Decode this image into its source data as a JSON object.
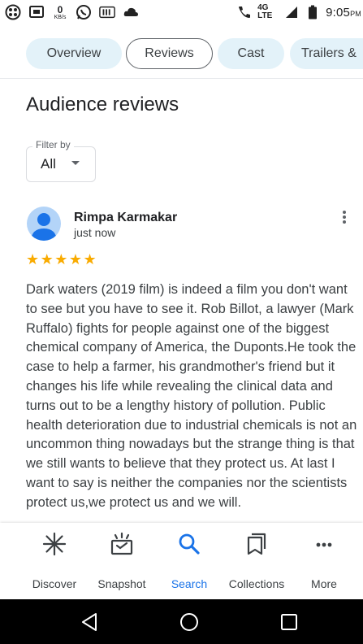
{
  "status_bar": {
    "left_icons": [
      "app-icon",
      "screen-icon",
      "data-speed-icon",
      "whatsapp-icon",
      "app-box-icon",
      "cloud-icon"
    ],
    "data_speed_value": "0",
    "data_speed_unit": "KB/s",
    "network_label": "4G LTE",
    "time": "9:05",
    "time_suffix": "PM"
  },
  "tabs": [
    {
      "label": "Overview",
      "active": false
    },
    {
      "label": "Reviews",
      "active": true
    },
    {
      "label": "Cast",
      "active": false
    },
    {
      "label": "Trailers &",
      "active": false
    }
  ],
  "section": {
    "title": "Audience reviews"
  },
  "filter": {
    "label": "Filter by",
    "value": "All"
  },
  "review": {
    "author": "Rimpa Karmakar",
    "time": "just now",
    "stars": "★★★★★",
    "rating": 5,
    "text": "Dark waters (2019 film) is indeed a film you don't want to see but you have to see it. Rob Billot, a lawyer (Mark Ruffalo) fights for people against one of the biggest chemical company of America, the Duponts.He took the case to help a farmer, his grandmother's friend but it changes his life while revealing the clinical data and turns out to be a lengthy history of pollution. Public health deterioration due to industrial chemicals is not an uncommon thing nowadays but the strange thing is that we still wants to believe that they protect us. At last I want to say is neither the companies nor the scientists protect us,we protect us and we will."
  },
  "bottom_nav": [
    {
      "label": "Discover",
      "icon": "asterisk-icon",
      "active": false
    },
    {
      "label": "Snapshot",
      "icon": "snapshot-icon",
      "active": false
    },
    {
      "label": "Search",
      "icon": "search-icon",
      "active": true
    },
    {
      "label": "Collections",
      "icon": "collections-icon",
      "active": false
    },
    {
      "label": "More",
      "icon": "more-horiz-icon",
      "active": false
    }
  ],
  "colors": {
    "accent": "#1a73e8",
    "tab_bg": "#e3f2f9",
    "star": "#f9ab00",
    "avatar": "#b3d4f8"
  }
}
